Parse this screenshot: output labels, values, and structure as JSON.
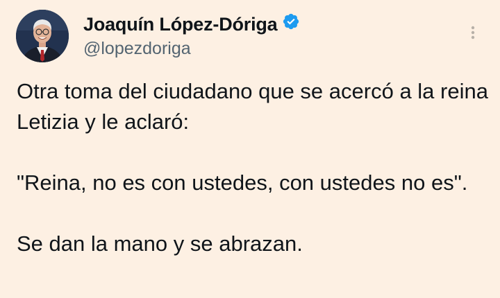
{
  "author": {
    "display_name": "Joaquín López-Dóriga",
    "handle": "@lopezdoriga",
    "verified": true,
    "verified_badge_color": "#1d9bf0",
    "avatar_icon": "profile-photo"
  },
  "menu": {
    "icon": "more-vertical-icon"
  },
  "tweet": {
    "paragraphs": [
      "Otra toma del ciudadano que se acercó a la reina Letizia y le aclaró:",
      "\"Reina, no es con ustedes, con ustedes no es\".",
      "Se dan la mano y se abrazan."
    ]
  },
  "colors": {
    "background": "#fdf0e3",
    "text": "#0f1419",
    "secondary_text": "#536471"
  }
}
